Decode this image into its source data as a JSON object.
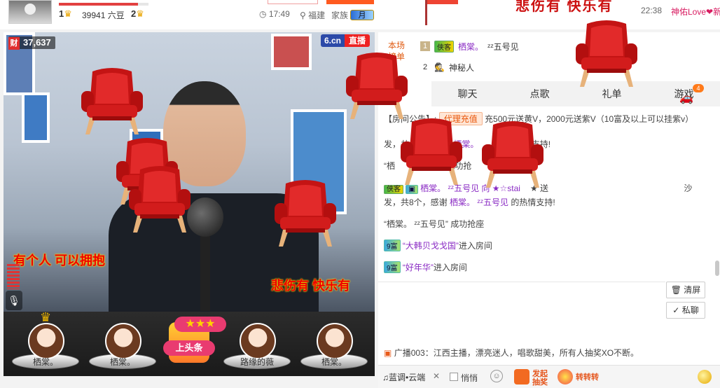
{
  "header": {
    "level_left": "1",
    "level_right": "2",
    "beans": "39941 六豆",
    "time": "17:49",
    "location": "福建",
    "family_label": "家族",
    "family_badge": "月",
    "headline_text": "悲伤有 快乐有",
    "clock": "22:38",
    "username": "神佑Love❤新"
  },
  "video": {
    "wealth_icon": "财",
    "viewers": "37,637",
    "brand": "6.cn",
    "live_label": "直播",
    "lyric_left": "有个人 可以拥抱",
    "lyric_right": "悲伤有 快乐有"
  },
  "seats": [
    {
      "name": "栖棠。",
      "crowned": true
    },
    {
      "name": "栖棠。",
      "crowned": false
    },
    {
      "name": "上头条",
      "special": true
    },
    {
      "name": "路缘的薇",
      "crowned": false
    },
    {
      "name": "栖棠。",
      "crowned": false
    }
  ],
  "rank": {
    "label": "本场榜单",
    "rows": [
      {
        "num": "1",
        "tag": "侠客",
        "name": "栖棠。",
        "extra": "ᶻᶻ五号见"
      },
      {
        "num": "2",
        "tag": "",
        "name": "神秘人",
        "extra": ""
      }
    ]
  },
  "tabs": [
    "聊天",
    "点歌",
    "礼单",
    "游戏"
  ],
  "car_badge": "4",
  "chat": {
    "announce_prefix": "【房间公告】:",
    "announce_pill": "代理充值",
    "announce_text": "充500元送黄V，2000元送紫V（10富及以上可以挂紫v）",
    "line1_a": "发，共",
    "line1_nick": "栖棠。",
    "line1_b": "情支持!",
    "line2_a": "“栖",
    "line2_b": "成功抢",
    "line3_nick": "栖棠。",
    "line3_b": "ᶻᶻ五号见 向 ★☆stai",
    "line3_c": "★ 送",
    "line3_d": "沙",
    "line4_a": "发，共8个，感谢",
    "line4_nick": "栖棠。",
    "line4_b": "ᶻᶻ五号见",
    "line4_c": "的热情支持!",
    "line5": "“栖棠。 ᶻᶻ五号见” 成功抢座",
    "line6_badge": "9富",
    "line6_name": "“大韩贝戈戈国”",
    "line6_tail": "进入房间",
    "line7_badge": "9富",
    "line7_name": "“好年华”",
    "line7_tail": "进入房间"
  },
  "tools": {
    "clear": "清屏",
    "private": "私聊"
  },
  "broadcast": "广播003：江西主播，漂亮迷人，唱歌甜美，所有人抽奖XO不断。",
  "inputbar": {
    "song": "♫蓝调•云端",
    "whisper": "悄悄",
    "lottery": "发起\n抽奖",
    "spin": "转转转"
  }
}
